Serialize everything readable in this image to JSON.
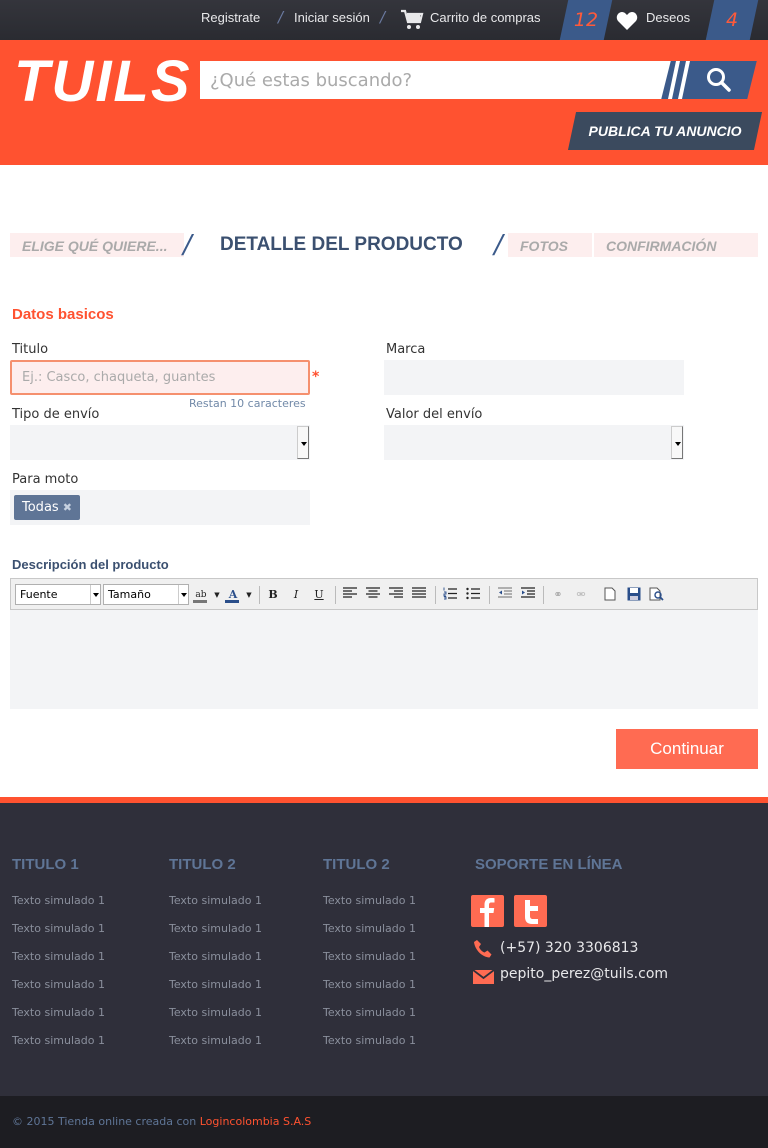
{
  "topbar": {
    "register": "Registrate",
    "login": "Iniciar sesión",
    "cart": "Carrito de compras",
    "cart_count": "12",
    "wishlist": "Deseos",
    "wishlist_count": "4",
    "separator": "/"
  },
  "header": {
    "logo": "TUILS",
    "search_placeholder": "¿Qué estas buscando?",
    "publish_button": "PUBLICA TU ANUNCIO"
  },
  "steps": [
    {
      "label": "ELIGE QUÉ QUIERE..."
    },
    {
      "label": "DETALLE DEL PRODUCTO"
    },
    {
      "label": "FOTOS"
    },
    {
      "label": "CONFIRMACIÓN"
    }
  ],
  "form": {
    "section_title": "Datos basicos",
    "titulo_label": "Titulo",
    "titulo_placeholder": "Ej.: Casco, chaqueta, guantes",
    "required_mark": "*",
    "remaining": "Restan  10 caracteres",
    "marca_label": "Marca",
    "tipo_envio_label": "Tipo de envío",
    "valor_envio_label": "Valor del envío",
    "para_moto_label": "Para moto",
    "para_moto_tag": "Todas",
    "descripcion_label": "Descripción del producto",
    "editor": {
      "font_select": "Fuente",
      "size_select": "Tamaño"
    },
    "continue_button": "Continuar"
  },
  "footer": {
    "columns": [
      {
        "title": "TITULO 1",
        "items": [
          "Texto simulado 1",
          "Texto simulado 1",
          "Texto simulado 1",
          "Texto simulado 1",
          "Texto simulado 1",
          "Texto simulado 1"
        ]
      },
      {
        "title": "TITULO 2",
        "items": [
          "Texto simulado 1",
          "Texto simulado 1",
          "Texto simulado 1",
          "Texto simulado 1",
          "Texto simulado 1",
          "Texto simulado 1"
        ]
      },
      {
        "title": "TITULO 2",
        "items": [
          "Texto simulado 1",
          "Texto simulado 1",
          "Texto simulado 1",
          "Texto simulado 1",
          "Texto simulado 1",
          "Texto simulado 1"
        ]
      }
    ],
    "support_title": "SOPORTE EN LÍNEA",
    "phone": "(+57) 320 3306813",
    "email": "pepito_perez@tuils.com",
    "copyright": "© 2015 Tienda online creada con ",
    "copyright_brand": "Logincolombia S.A.S"
  },
  "colors": {
    "primary_orange": "#ff5230",
    "navy": "#3b5a8a",
    "footer_bg": "#2f2f3a"
  },
  "icons": [
    "cart-icon",
    "heart-icon",
    "search-icon",
    "facebook-icon",
    "twitter-icon",
    "phone-icon",
    "mail-icon"
  ]
}
